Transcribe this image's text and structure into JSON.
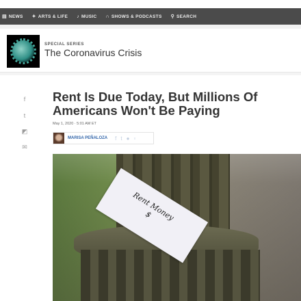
{
  "nav": {
    "items": [
      {
        "label": "NEWS",
        "icon": "news-icon"
      },
      {
        "label": "ARTS & LIFE",
        "icon": "arts-icon"
      },
      {
        "label": "MUSIC",
        "icon": "music-note-icon"
      },
      {
        "label": "SHOWS & PODCASTS",
        "icon": "headphones-icon"
      },
      {
        "label": "SEARCH",
        "icon": "search-icon"
      }
    ]
  },
  "series": {
    "kicker": "SPECIAL SERIES",
    "title": "The Coronavirus Crisis"
  },
  "article": {
    "title": "Rent Is Due Today, But Millions Of Americans Won't Be Paying",
    "date": "May 1, 2020 · 5:01 AM ET",
    "author": "MARISA PEÑALOZA",
    "photo_note": [
      "Rent Money",
      "$"
    ]
  }
}
